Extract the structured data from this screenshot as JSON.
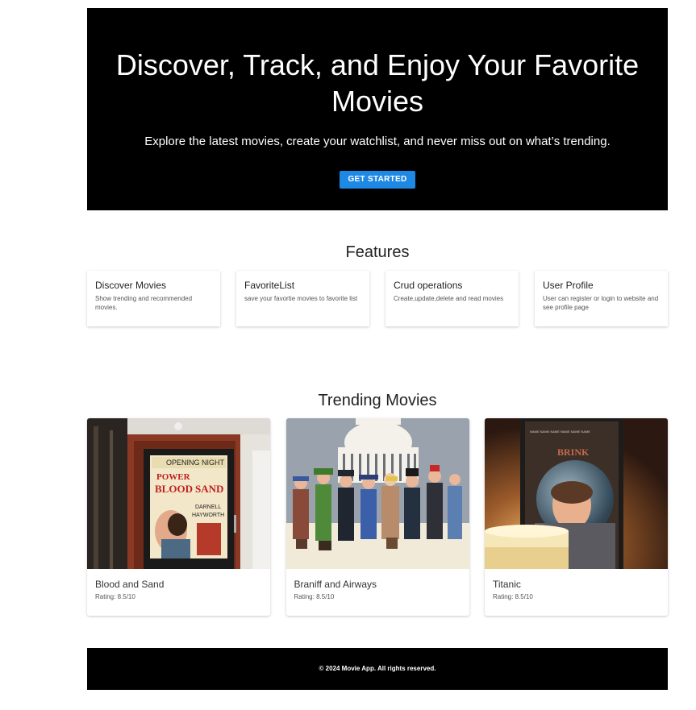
{
  "hero": {
    "title": "Discover, Track, and Enjoy Your Favorite Movies",
    "subtitle": "Explore the latest movies, create your watchlist, and never miss out on what’s trending.",
    "cta_label": "GET STARTED",
    "cta_color": "#1e88e5"
  },
  "features": {
    "title": "Features",
    "items": [
      {
        "title": "Discover Movies",
        "description": "Show trending and recommended movies."
      },
      {
        "title": "FavoriteList",
        "description": "save your favortie movies to favorite list"
      },
      {
        "title": "Crud operations",
        "description": "Create,update,delete and read movies"
      },
      {
        "title": "User Profile",
        "description": "User can register or login to website and see profile page"
      }
    ]
  },
  "trending": {
    "title": "Trending Movies",
    "movies": [
      {
        "title": "Blood and Sand",
        "rating": "Rating: 8.5/10",
        "poster_icon": "cinema-poster-image"
      },
      {
        "title": "Braniff and Airways",
        "rating": "Rating: 8.5/10",
        "poster_icon": "illustration-image"
      },
      {
        "title": "Titanic",
        "rating": "Rating: 8.5/10",
        "poster_icon": "astronaut-poster-image"
      }
    ]
  },
  "footer": {
    "text": "© 2024 Movie App. All rights reserved."
  }
}
